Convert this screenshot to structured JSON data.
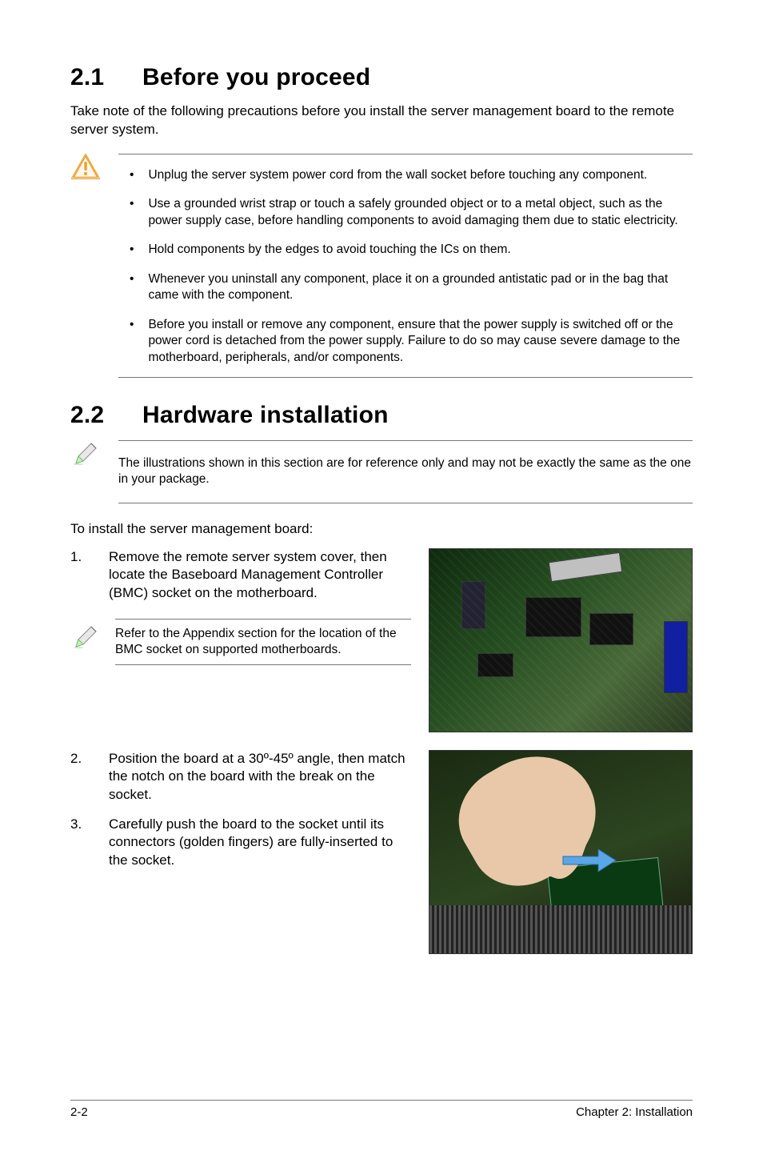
{
  "section1": {
    "number": "2.1",
    "title": "Before you proceed",
    "intro": "Take note of the following precautions before you install the server management board to the remote server system.",
    "bullets": [
      "Unplug the server system power cord from the wall socket before touching any component.",
      "Use a grounded wrist strap or touch a safely grounded object or to a metal object, such as the power supply case, before handling components to avoid damaging them due to static electricity.",
      "Hold components by the edges to avoid touching the ICs on them.",
      "Whenever you uninstall any component, place it on a grounded antistatic pad or in the bag that came with the component.",
      "Before you install or remove any component, ensure that the power supply is switched off or the power cord is detached from the power supply. Failure to do so may cause severe damage to the motherboard, peripherals, and/or components."
    ]
  },
  "section2": {
    "number": "2.2",
    "title": "Hardware installation",
    "note": "The illustrations shown in this section are for reference only and may not be exactly the same as the one in your package.",
    "lead": "To install the server management board:",
    "steps": [
      "Remove the remote server system cover, then locate the Baseboard Management Controller (BMC) socket on the motherboard.",
      "Position the board at a 30º-45º angle, then match the notch on the board with the break on the socket.",
      "Carefully push the board to the socket until its connectors (golden fingers) are fully-inserted to the socket."
    ],
    "inline_note": "Refer to the Appendix section for the location of the BMC socket on supported motherboards."
  },
  "footer": {
    "left": "2-2",
    "right": "Chapter 2: Installation"
  }
}
